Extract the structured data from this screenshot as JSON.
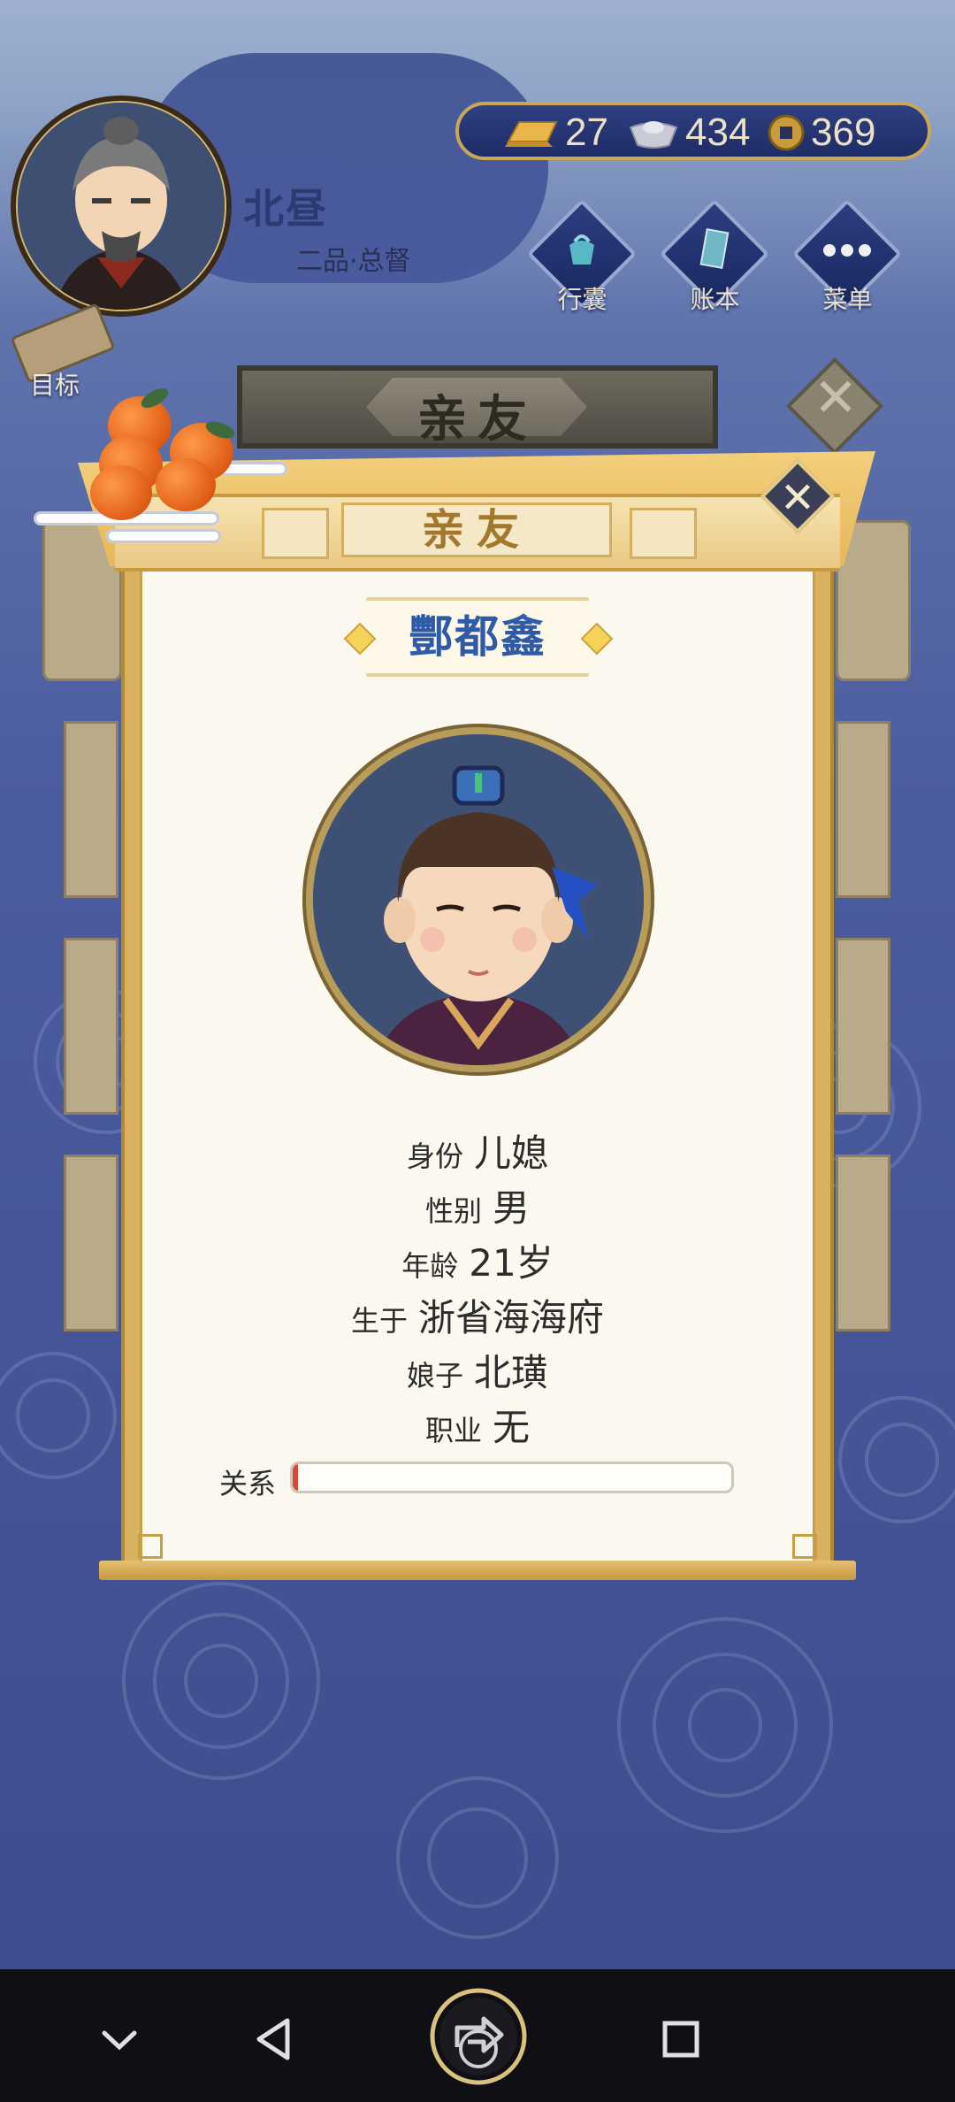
{
  "player": {
    "name": "北昼",
    "rank": "二品·总督"
  },
  "currency": {
    "gold": "27",
    "silver": "434",
    "coins": "369"
  },
  "top_menu": [
    {
      "label": "行囊",
      "icon": "bag-icon"
    },
    {
      "label": "账本",
      "icon": "ledger-icon"
    },
    {
      "label": "菜单",
      "icon": "more-icon"
    }
  ],
  "goal": {
    "label": "目标",
    "icon": "scroll-icon"
  },
  "panel_title": "亲友",
  "dialog": {
    "title": "亲友",
    "name": "酆都鑫",
    "info": [
      {
        "key": "身份",
        "value": "儿媳"
      },
      {
        "key": "性别",
        "value": "男"
      },
      {
        "key": "年龄",
        "value": "21岁"
      },
      {
        "key": "生于",
        "value": "浙省海海府"
      },
      {
        "key": "娘子",
        "value": "北璜"
      },
      {
        "key": "职业",
        "value": "无"
      }
    ],
    "relation": {
      "label": "关系",
      "value": 0.01
    }
  },
  "navbar": {
    "icons": [
      "chevron-down-icon",
      "back-icon",
      "share-icon",
      "recents-icon"
    ]
  },
  "colors": {
    "accent": "#2e5aa6",
    "gold": "#d8b260",
    "background": "#4a5a9e"
  }
}
